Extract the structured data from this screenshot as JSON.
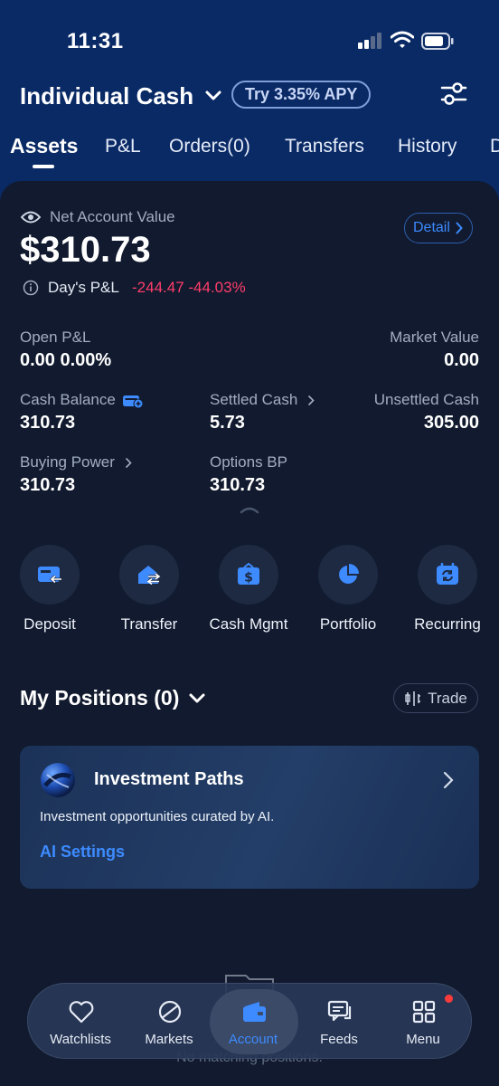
{
  "status_bar": {
    "time": "11:31"
  },
  "header": {
    "account_name": "Individual Cash",
    "apy_badge": "Try 3.35% APY"
  },
  "tabs": [
    {
      "label": "Assets",
      "active": true
    },
    {
      "label": "P&L"
    },
    {
      "label": "Orders(0)"
    },
    {
      "label": "Transfers"
    },
    {
      "label": "History"
    },
    {
      "label": "D"
    }
  ],
  "summary": {
    "nav_label": "Net Account Value",
    "nav_value": "$310.73",
    "detail_label": "Detail",
    "days_pl_label": "Day's P&L",
    "days_pl_value": "-244.47 -44.03%"
  },
  "metrics": {
    "open_pl_label": "Open P&L",
    "open_pl_value": "0.00 0.00%",
    "market_value_label": "Market Value",
    "market_value_value": "0.00",
    "cash_balance_label": "Cash Balance",
    "cash_balance_value": "310.73",
    "settled_cash_label": "Settled Cash",
    "settled_cash_value": "5.73",
    "unsettled_cash_label": "Unsettled Cash",
    "unsettled_cash_value": "305.00",
    "buying_power_label": "Buying Power",
    "buying_power_value": "310.73",
    "options_bp_label": "Options BP",
    "options_bp_value": "310.73"
  },
  "quick_actions": [
    {
      "label": "Deposit",
      "icon": "deposit-icon"
    },
    {
      "label": "Transfer",
      "icon": "transfer-icon"
    },
    {
      "label": "Cash Mgmt",
      "icon": "cash-mgmt-icon"
    },
    {
      "label": "Portfolio",
      "icon": "pie-chart-icon"
    },
    {
      "label": "Recurring",
      "icon": "recurring-icon"
    }
  ],
  "positions": {
    "title": "My Positions (0)",
    "trade_label": "Trade",
    "empty_text": "No matching positions."
  },
  "investment_paths": {
    "title": "Investment Paths",
    "description": "Investment opportunities curated by AI.",
    "link": "AI Settings"
  },
  "bottom_nav": [
    {
      "label": "Watchlists",
      "icon": "heart-icon"
    },
    {
      "label": "Markets",
      "icon": "planet-icon"
    },
    {
      "label": "Account",
      "icon": "wallet-icon",
      "active": true
    },
    {
      "label": "Feeds",
      "icon": "chat-icon"
    },
    {
      "label": "Menu",
      "icon": "grid-icon",
      "badge": true
    }
  ],
  "colors": {
    "header_bg": "#0a2a66",
    "card_bg": "#111a2e",
    "accent_blue": "#3d8bff",
    "loss_red": "#ff3d6b"
  }
}
